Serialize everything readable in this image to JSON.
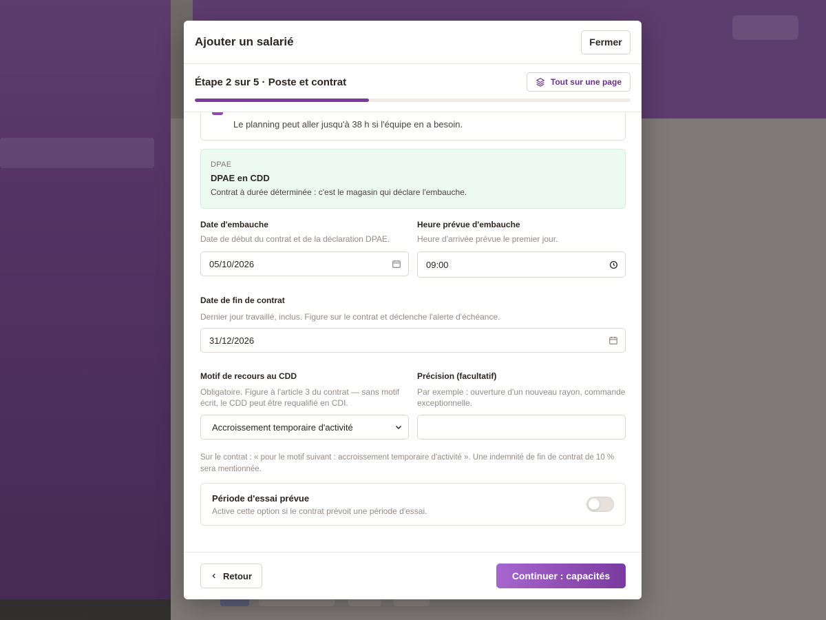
{
  "modal": {
    "title": "Ajouter un salarié",
    "close_label": "Fermer"
  },
  "step": {
    "title": "Étape 2 sur 5 · Poste et contrat",
    "one_page_label": "Tout sur une page",
    "progress_fraction": 0.4
  },
  "hours_option": {
    "description": "Le planning peut aller jusqu'à 38 h si l'équipe en a besoin."
  },
  "dpae": {
    "kicker": "DPAE",
    "title": "DPAE en CDD",
    "description": "Contrat à durée déterminée : c'est le magasin qui déclare l'embauche."
  },
  "hire_date": {
    "label": "Date d'embauche",
    "help": "Date de début du contrat et de la déclaration DPAE.",
    "value": "05/10/2026"
  },
  "hire_time": {
    "label": "Heure prévue d'embauche",
    "help": "Heure d'arrivée prévue le premier jour.",
    "value": "09:00"
  },
  "end_date": {
    "label": "Date de fin de contrat",
    "help": "Dernier jour travaillé, inclus. Figure sur le contrat et déclenche l'alerte d'échéance.",
    "value": "31/12/2026"
  },
  "reason": {
    "label": "Motif de recours au CDD",
    "help": "Obligatoire. Figure à l'article 3 du contrat — sans motif écrit, le CDD peut être requalifié en CDI.",
    "value": "Accroissement temporaire d'activité"
  },
  "precision": {
    "label": "Précision (facultatif)",
    "help": "Par exemple : ouverture d'un nouveau rayon, commande exceptionnelle.",
    "value": ""
  },
  "contract_note": "Sur le contrat : « pour le motif suivant : accroissement temporaire d'activité ». Une indemnité de fin de contrat de 10 % sera mentionnée.",
  "trial": {
    "title": "Période d'essai prévue",
    "description": "Active cette option si le contrat prévoit une période d'essai.",
    "enabled": false
  },
  "footer": {
    "back_label": "Retour",
    "continue_label": "Continuer : capacités"
  },
  "colors": {
    "accent": "#7b3a9e",
    "accent_light": "#a766cf",
    "success_bg": "#edfaf2"
  }
}
